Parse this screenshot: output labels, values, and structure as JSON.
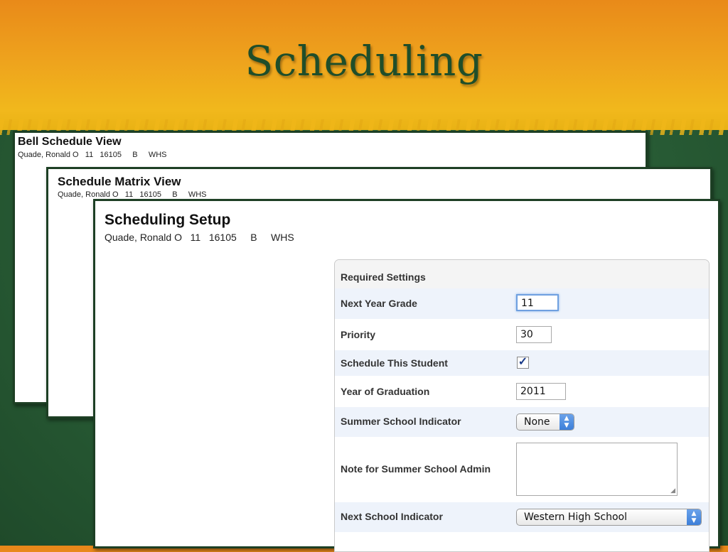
{
  "slide": {
    "title": "Scheduling"
  },
  "windows": {
    "bell": {
      "title": "Bell Schedule View",
      "student_line": "Quade, Ronald O   11   16105     B     WHS"
    },
    "matrix": {
      "title": "Schedule Matrix View",
      "student_line": "Quade, Ronald O   11   16105     B     WHS"
    },
    "setup": {
      "title": "Scheduling Setup",
      "student_line": "Quade, Ronald O   11   16105     B     WHS"
    }
  },
  "settings": {
    "header": "Required Settings",
    "next_year_grade": {
      "label": "Next Year Grade",
      "value": "11"
    },
    "priority": {
      "label": "Priority",
      "value": "30"
    },
    "schedule_this_student": {
      "label": "Schedule This Student",
      "checked": true,
      "mark": "✓"
    },
    "year_of_graduation": {
      "label": "Year of Graduation",
      "value": "2011"
    },
    "summer_school_indicator": {
      "label": "Summer School Indicator",
      "value": "None"
    },
    "note_for_summer_school_admin": {
      "label": "Note for Summer School Admin",
      "value": ""
    },
    "next_school_indicator": {
      "label": "Next School Indicator",
      "value": "Western High School"
    }
  },
  "colors": {
    "accent": "#3d7fd9",
    "background_green": "#2a5f36",
    "banner_orange": "#eea21d",
    "title_green": "#1f4e2a"
  },
  "icons": {
    "select_arrow": "up-down-arrows-icon",
    "resize_grip": "resize-grip-icon",
    "checkmark": "checkmark-icon"
  }
}
